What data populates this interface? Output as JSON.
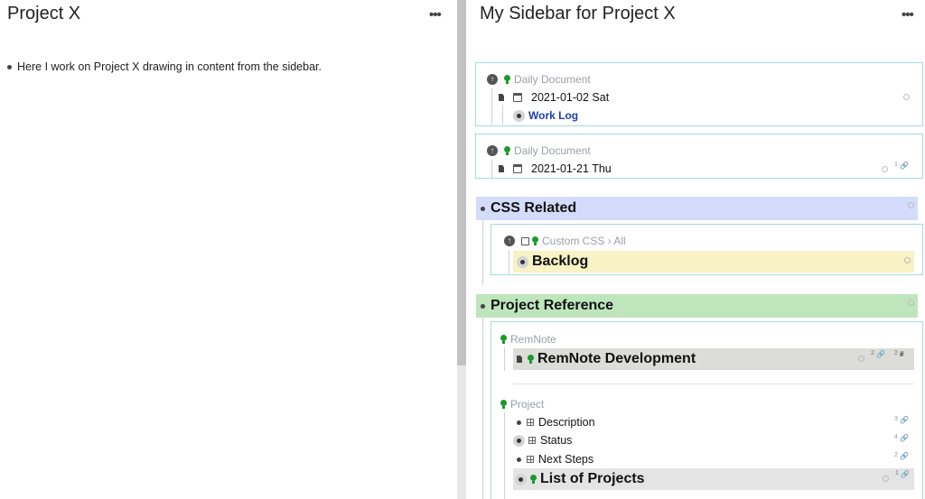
{
  "left": {
    "title": "Project X",
    "more": "•••",
    "bullet_text": "Here I work on Project X drawing in content from the sidebar."
  },
  "right": {
    "title": "My Sidebar for Project X",
    "more": "•••",
    "portal1": {
      "breadcrumb": "Daily Document",
      "date": "2021-01-02 Sat",
      "child": "Work Log"
    },
    "portal2": {
      "breadcrumb": "Daily Document",
      "date": "2021-01-21 Thu",
      "ref_count": "1"
    },
    "css_related": {
      "title": "CSS Related",
      "bg_color": "#d3dcfa",
      "breadcrumb": "Custom CSS › All",
      "backlog": "Backlog",
      "backlog_bg": "#f8f2c4"
    },
    "project_reference": {
      "title": "Project Reference",
      "bg_color": "#bfe5bd",
      "remnote_breadcrumb": "RemNote",
      "remnote_dev": "RemNote Development",
      "remnote_dev_counts": [
        "2",
        "2"
      ],
      "project_breadcrumb": "Project",
      "items": [
        {
          "label": "Description",
          "count": "3"
        },
        {
          "label": "Status",
          "count": "4"
        },
        {
          "label": "Next Steps",
          "count": "2"
        }
      ],
      "list_of_projects": "List of Projects",
      "list_count": "1"
    }
  }
}
